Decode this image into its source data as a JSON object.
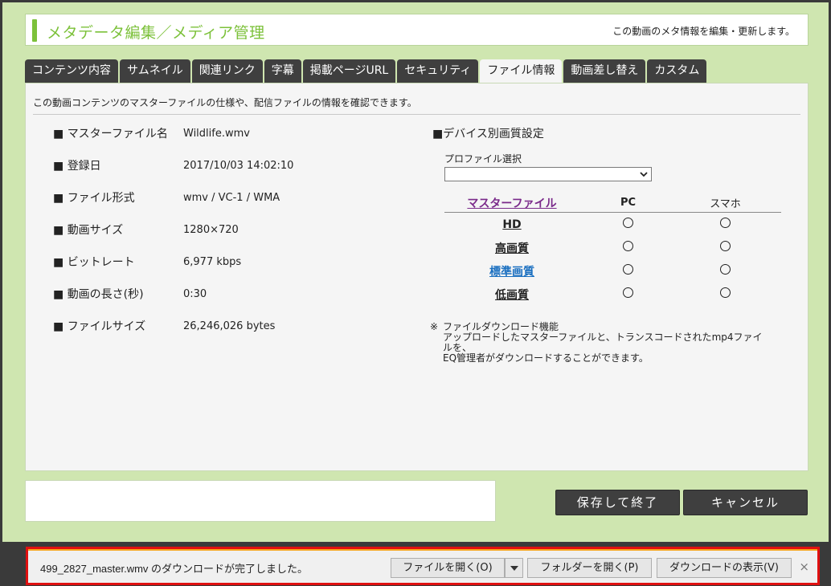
{
  "header": {
    "title": "メタデータ編集／メディア管理",
    "description": "この動画のメタ情報を編集・更新します。"
  },
  "tabs": [
    {
      "label": "コンテンツ内容"
    },
    {
      "label": "サムネイル"
    },
    {
      "label": "関連リンク"
    },
    {
      "label": "字幕"
    },
    {
      "label": "掲載ページURL"
    },
    {
      "label": "セキュリティ"
    },
    {
      "label": "ファイル情報",
      "active": true
    },
    {
      "label": "動画差し替え"
    },
    {
      "label": "カスタム"
    }
  ],
  "panel": {
    "intro": "この動画コンテンツのマスターファイルの仕様や、配信ファイルの情報を確認できます。",
    "file_info": [
      {
        "label": "マスターファイル名",
        "value": "Wildlife.wmv"
      },
      {
        "label": "登録日",
        "value": "2017/10/03 14:02:10"
      },
      {
        "label": "ファイル形式",
        "value": "wmv / VC-1 / WMA"
      },
      {
        "label": "動画サイズ",
        "value": "1280×720"
      },
      {
        "label": "ビットレート",
        "value": "6,977 kbps"
      },
      {
        "label": "動画の長さ(秒)",
        "value": "0:30"
      },
      {
        "label": "ファイルサイズ",
        "value": "26,246,026 bytes"
      }
    ],
    "device": {
      "title": "デバイス別画質設定",
      "profile_label": "プロファイル選択",
      "profile_selected": "",
      "columns": {
        "master": "マスターファイル",
        "pc": "PC",
        "smartphone": "スマホ"
      },
      "rows": [
        {
          "label": "HD",
          "link": false
        },
        {
          "label": "高画質",
          "link": false
        },
        {
          "label": "標準画質",
          "link": true
        },
        {
          "label": "低画質",
          "link": false
        }
      ]
    },
    "note": {
      "mark": "※",
      "line1": "ファイルダウンロード機能",
      "line2": "アップロードしたマスターファイルと、トランスコードされたmp4ファイルを、",
      "line3": "EQ管理者がダウンロードすることができます。"
    }
  },
  "buttons": {
    "save": "保存して終了",
    "cancel": "キャンセル"
  },
  "download_bar": {
    "message": "499_2827_master.wmv のダウンロードが完了しました。",
    "open_file": "ファイルを開く(O)",
    "open_folder": "フォルダーを開く(P)",
    "show_downloads": "ダウンロードの表示(V)",
    "close": "×"
  },
  "colors": {
    "accent_green": "#7cc13a",
    "tab_dark": "#3f3f3f",
    "link_blue": "#1a6fc0",
    "link_purple": "#7a2a8a",
    "highlight_red": "#e01010"
  }
}
